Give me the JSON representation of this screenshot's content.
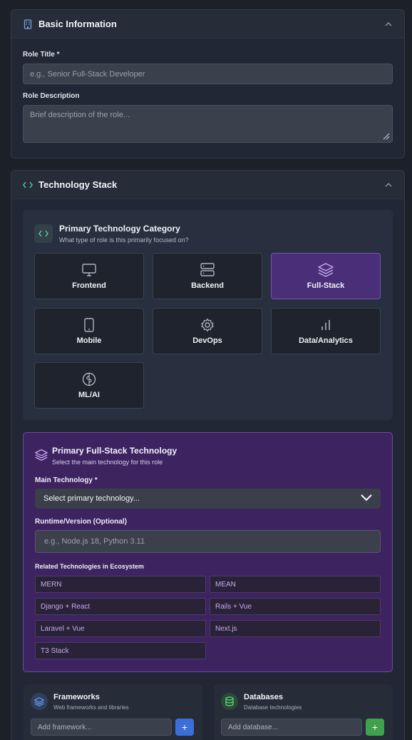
{
  "basic": {
    "title": "Basic Information",
    "role_title_label": "Role Title *",
    "role_title_placeholder": "e.g., Senior Full-Stack Developer",
    "role_desc_label": "Role Description",
    "role_desc_placeholder": "Brief description of the role..."
  },
  "tech": {
    "title": "Technology Stack",
    "category": {
      "title": "Primary Technology Category",
      "subtitle": "What type of role is this primarily focused on?",
      "items": [
        {
          "label": "Frontend",
          "icon": "monitor-icon"
        },
        {
          "label": "Backend",
          "icon": "server-icon"
        },
        {
          "label": "Full-Stack",
          "icon": "layers-icon",
          "selected": true
        },
        {
          "label": "Mobile",
          "icon": "smartphone-icon"
        },
        {
          "label": "DevOps",
          "icon": "gear-icon"
        },
        {
          "label": "Data/Analytics",
          "icon": "bar-chart-icon"
        },
        {
          "label": "ML/AI",
          "icon": "brain-icon"
        }
      ]
    },
    "primary": {
      "title": "Primary Full-Stack Technology",
      "subtitle": "Select the main technology for this role",
      "main_label": "Main Technology *",
      "main_value": "Select primary technology...",
      "runtime_label": "Runtime/Version (Optional)",
      "runtime_placeholder": "e.g., Node.js 18, Python 3.11",
      "related_label": "Related Technologies in Ecosystem",
      "related": [
        "MERN",
        "MEAN",
        "Django + React",
        "Rails + Vue",
        "Laravel + Vue",
        "Next.js",
        "T3 Stack"
      ]
    },
    "frameworks": {
      "title": "Frameworks",
      "subtitle": "Web frameworks and libraries",
      "placeholder": "Add framework...",
      "button": "+"
    },
    "databases": {
      "title": "Databases",
      "subtitle": "Database technologies",
      "placeholder": "Add database...",
      "button": "+"
    }
  },
  "colors": {
    "accent_purple": "#7c5cc4",
    "selected_tile": "#4a2f78",
    "blue_button": "#3b6fd8",
    "green_button": "#3fa14c"
  }
}
